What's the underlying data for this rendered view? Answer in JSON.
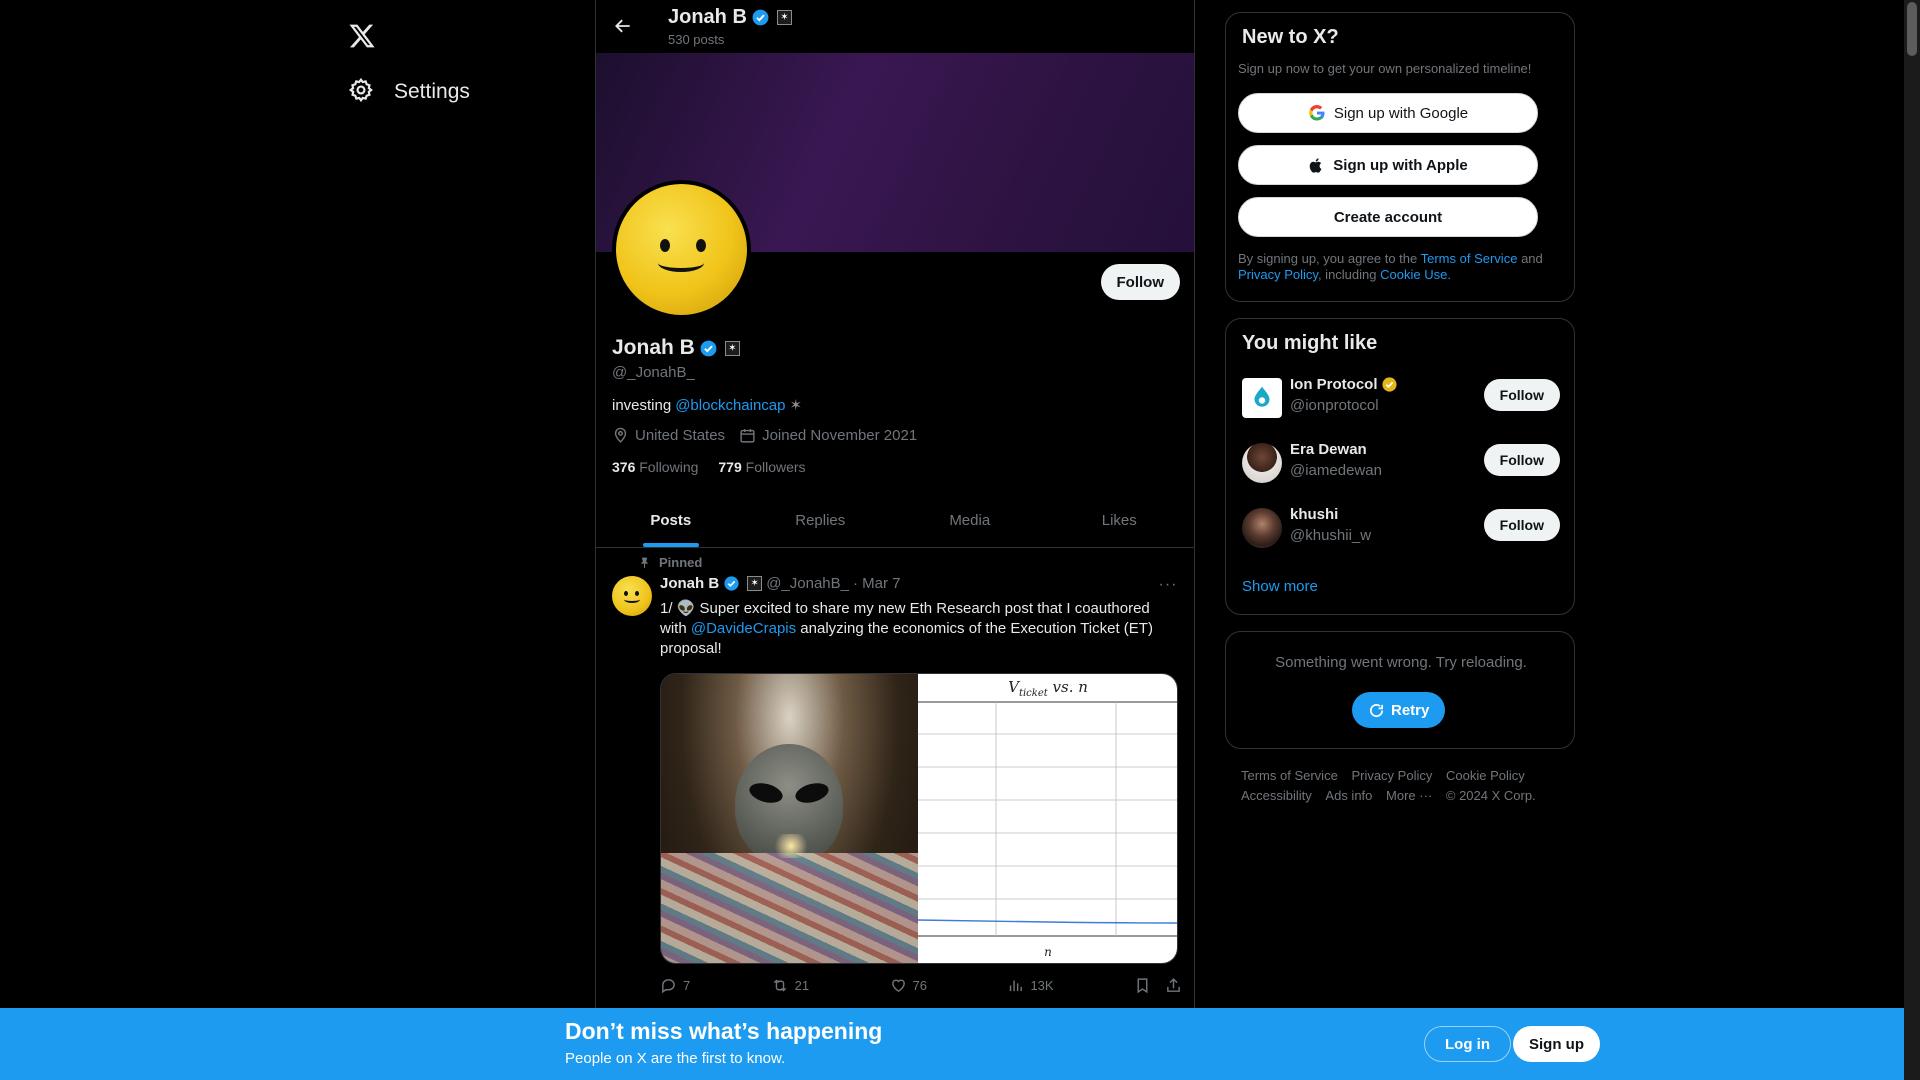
{
  "nav": {
    "settings_label": "Settings",
    "logo": "x-logo-icon"
  },
  "header": {
    "name": "Jonah B",
    "posts_count": "530 posts"
  },
  "profile": {
    "name": "Jonah B",
    "handle": "@_JonahB_",
    "bio_prefix": "investing",
    "bio_mention": "@blockchaincap",
    "location": "United States",
    "joined": "Joined November 2021",
    "following_count": "376",
    "following_label": "Following",
    "followers_count": "779",
    "followers_label": "Followers",
    "follow_label": "Follow"
  },
  "tabs": [
    {
      "label": "Posts",
      "active": true
    },
    {
      "label": "Replies"
    },
    {
      "label": "Media"
    },
    {
      "label": "Likes"
    }
  ],
  "tweet": {
    "pinned_label": "Pinned",
    "name": "Jonah B",
    "handle": "@_JonahB_",
    "date": "· Mar 7",
    "text_part1": "1/ 👽 Super excited to share my new Eth Research post that I coauthored with",
    "mention": "@DavideCrapis",
    "text_part2": "analyzing the economics of the Execution Ticket (ET) proposal!",
    "chart_title_main": "V",
    "chart_title_sub": "ticket",
    "chart_title_rest": " vs. n",
    "chart_xlabel": "n",
    "replies": "7",
    "reposts": "21",
    "likes": "76",
    "views": "13K"
  },
  "new_to_x": {
    "title": "New to X?",
    "subtitle": "Sign up now to get your own personalized timeline!",
    "google_label": "Sign up with Google",
    "apple_label": "Sign up with Apple",
    "create_label": "Create account",
    "legal_1": "By signing up, you agree to the",
    "terms": "Terms of Service",
    "legal_and": "and",
    "privacy": "Privacy Policy",
    "legal_including": ", including",
    "cookie": "Cookie Use."
  },
  "you_might_like": {
    "title": "You might like",
    "suggestions": [
      {
        "name": "Ion Protocol",
        "handle": "@ionprotocol",
        "follow": "Follow"
      },
      {
        "name": "Era Dewan",
        "handle": "@iamedewan",
        "follow": "Follow"
      },
      {
        "name": "khushi",
        "handle": "@khushii_w",
        "follow": "Follow"
      }
    ],
    "show_more": "Show more"
  },
  "error_card": {
    "message": "Something went wrong. Try reloading.",
    "retry_label": "Retry"
  },
  "footer": {
    "links": [
      "Terms of Service",
      "Privacy Policy",
      "Cookie Policy",
      "Accessibility",
      "Ads info",
      "More ···",
      "© 2024 X Corp."
    ]
  },
  "bottom_banner": {
    "title": "Don’t miss what’s happening",
    "subtitle": "People on X are the first to know.",
    "login_label": "Log in",
    "signup_label": "Sign up"
  },
  "colors": {
    "accent": "#1d9bf0",
    "background": "#000000",
    "text": "#e7e9ea",
    "muted": "#71767b",
    "gold_badge": "#e2b719"
  }
}
